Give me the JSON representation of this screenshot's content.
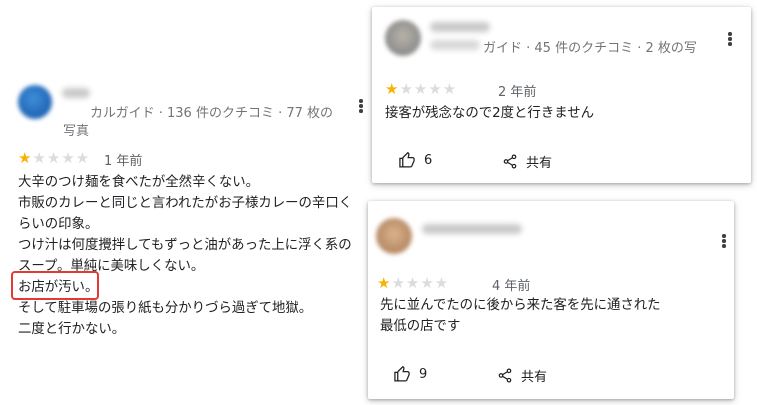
{
  "main_review": {
    "reviewer_meta_line1": "カルガイド · 136 件のクチコミ · 77 枚の",
    "reviewer_meta_line2": "写真",
    "rating": 1,
    "date": "1 年前",
    "lines": [
      "大辛のつけ麺を食べたが全然辛くない。",
      "市販のカレーと同じと言われたがお子様カレーの辛口く",
      "らいの印象。",
      "つけ汁は何度攪拌してもずっと油があった上に浮く系の",
      "スープ。単純に美味しくない。"
    ],
    "highlighted_line": "お店が汚い。",
    "lines_after": [
      "そして駐車場の張り紙も分かりづら過ぎて地獄。",
      "二度と行かない。"
    ]
  },
  "card_top": {
    "reviewer_meta": "ガイド · 45 件のクチコミ · 2 枚の写",
    "rating": 1,
    "date": "2 年前",
    "text": "接客が残念なので2度と行きません",
    "like_count": "6",
    "share_label": "共有"
  },
  "card_bottom": {
    "rating": 1,
    "date": "4 年前",
    "lines": [
      "先に並んでたのに後から来た客を先に通された",
      "最低の店です"
    ],
    "like_count": "9",
    "share_label": "共有"
  },
  "icons": {
    "like": "thumbs-up-icon",
    "share": "share-icon",
    "menu": "more-vert-icon"
  },
  "colors": {
    "star_on": "#f6b400",
    "star_off": "#dadce0",
    "highlight": "#e53935"
  }
}
